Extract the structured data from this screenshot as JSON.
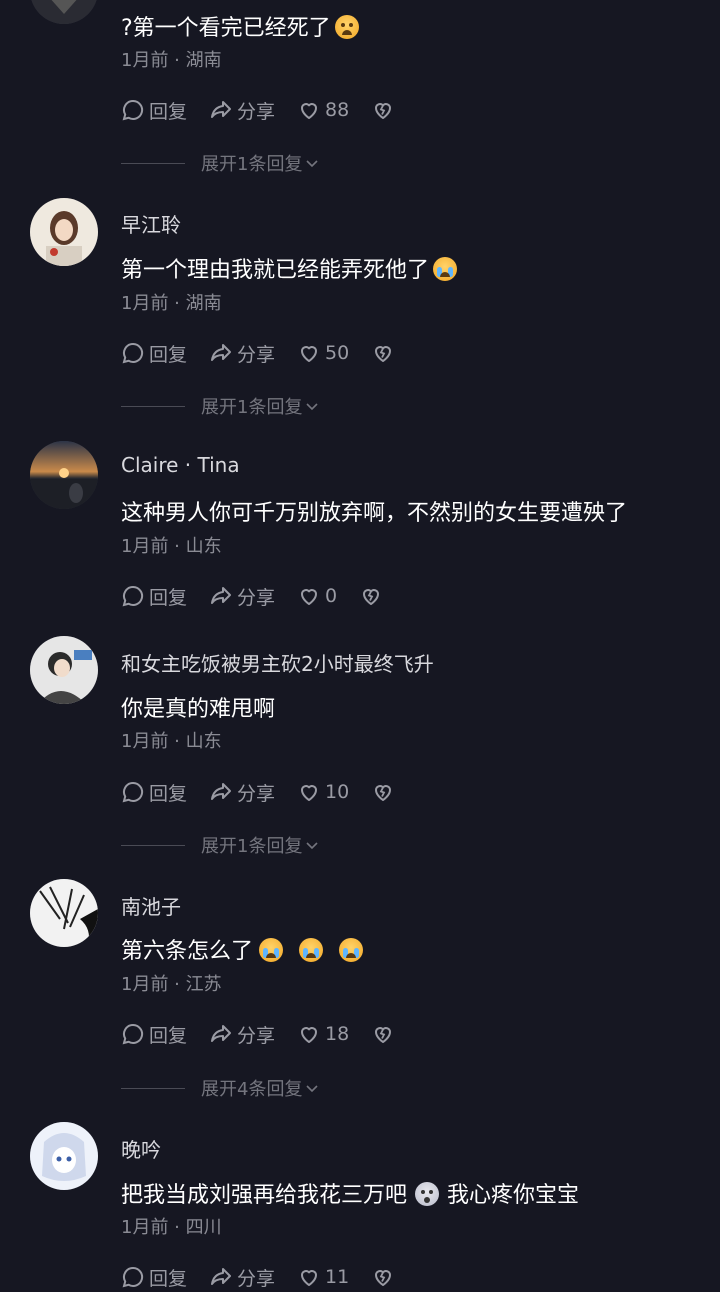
{
  "comments": [
    {
      "username": "",
      "text": "?第一个看完已经死了",
      "meta": "1月前 · 湖南",
      "reply": "回复",
      "share": "分享",
      "likes": "88",
      "expand": "展开1条回复",
      "emoji": [
        "grinning-sweat-emoji"
      ]
    },
    {
      "username": "早江聆",
      "text": "第一个理由我就已经能弄死他了",
      "meta": "1月前 · 湖南",
      "reply": "回复",
      "share": "分享",
      "likes": "50",
      "expand": "展开1条回复",
      "emoji": [
        "crying-emoji"
      ]
    },
    {
      "username": "Claire · Tina",
      "text": "这种男人你可千万别放弃啊，不然别的女生要遭殃了",
      "meta": "1月前 · 山东",
      "reply": "回复",
      "share": "分享",
      "likes": "0",
      "expand": "",
      "emoji": []
    },
    {
      "username": "和女主吃饭被男主砍2小时最终飞升",
      "text": "你是真的难甩啊",
      "meta": "1月前 · 山东",
      "reply": "回复",
      "share": "分享",
      "likes": "10",
      "expand": "展开1条回复",
      "emoji": []
    },
    {
      "username": "南池子",
      "text": "第六条怎么了",
      "meta": "1月前 · 江苏",
      "reply": "回复",
      "share": "分享",
      "likes": "18",
      "expand": "展开4条回复",
      "emoji": [
        "crying-emoji",
        "crying-emoji",
        "crying-emoji"
      ]
    },
    {
      "username": "晚吟",
      "text": "把我当成刘强再给我花三万吧",
      "text2": "我心疼你宝宝",
      "meta": "1月前 · 四川",
      "reply": "回复",
      "share": "分享",
      "likes": "11",
      "expand": "",
      "emoji": [
        "shocked-emoji"
      ]
    }
  ]
}
